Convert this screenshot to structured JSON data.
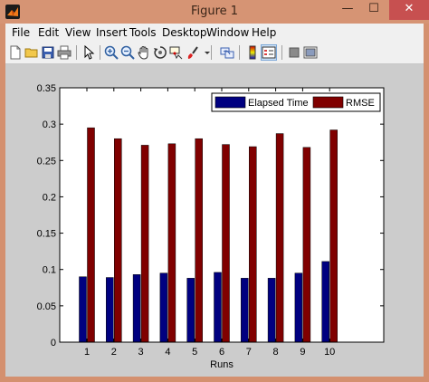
{
  "window": {
    "title": "Figure 1",
    "controls": {
      "minimize": "—",
      "maximize": "☐",
      "close": "✕"
    }
  },
  "menubar": {
    "items": [
      {
        "label": "File"
      },
      {
        "label": "Edit"
      },
      {
        "label": "View"
      },
      {
        "label": "Insert"
      },
      {
        "label": "Tools"
      },
      {
        "label": "Desktop"
      },
      {
        "label": "Window"
      },
      {
        "label": "Help"
      }
    ]
  },
  "toolbar": {
    "buttons": [
      "new-figure-icon",
      "open-file-icon",
      "save-icon",
      "print-icon",
      "edit-plot-arrow-icon",
      "zoom-in-icon",
      "zoom-out-icon",
      "pan-hand-icon",
      "rotate-3d-icon",
      "data-cursor-icon",
      "brush-icon",
      "link-plot-icon",
      "colorbar-icon",
      "legend-icon",
      "hide-plot-tools-icon",
      "show-plot-tools-icon"
    ]
  },
  "colors": {
    "elapsed": "#000080",
    "rmse": "#800000",
    "figure_bg": "#cccccc",
    "axes_bg": "#ffffff"
  },
  "chart_data": {
    "type": "bar",
    "title": "",
    "xlabel": "Runs",
    "ylabel": "",
    "categories": [
      "1",
      "2",
      "3",
      "4",
      "5",
      "6",
      "7",
      "8",
      "9",
      "10"
    ],
    "series": [
      {
        "name": "Elapsed Time",
        "values": [
          0.09,
          0.089,
          0.093,
          0.095,
          0.088,
          0.096,
          0.088,
          0.088,
          0.095,
          0.111
        ]
      },
      {
        "name": "RMSE",
        "values": [
          0.295,
          0.28,
          0.271,
          0.273,
          0.28,
          0.272,
          0.269,
          0.287,
          0.268,
          0.292
        ]
      }
    ],
    "ylim": [
      0,
      0.35
    ],
    "yticks": [
      "0",
      "0.05",
      "0.1",
      "0.15",
      "0.2",
      "0.25",
      "0.3",
      "0.35"
    ],
    "ytick_values": [
      0,
      0.05,
      0.1,
      0.15,
      0.2,
      0.25,
      0.3,
      0.35
    ],
    "grid": false,
    "legend_position": "top-right"
  }
}
